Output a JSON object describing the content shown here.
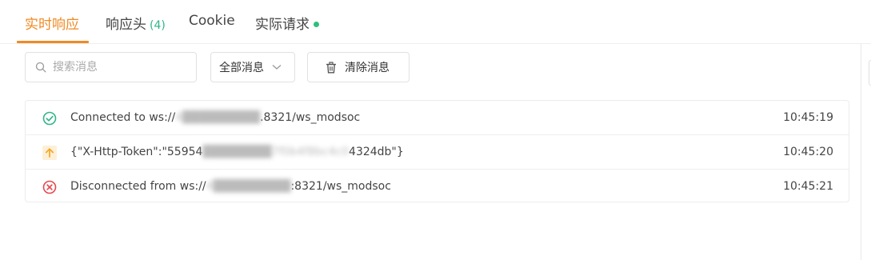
{
  "tabs": [
    {
      "label": "实时响应"
    },
    {
      "label": "响应头",
      "count": "(4)"
    },
    {
      "label": "Cookie"
    },
    {
      "label": "实际请求"
    }
  ],
  "toolbar": {
    "search_placeholder": "搜索消息",
    "filter_value": "全部消息",
    "clear_label": "清除消息"
  },
  "messages": [
    {
      "icon": "check-circle-icon",
      "prefix": "Connected to ws://",
      "redacted": "4█████████",
      "suffix": ".8321/ws_modsoc",
      "time": "10:45:19"
    },
    {
      "icon": "arrow-up-icon",
      "prefix": "{\"X-Http-Token\":\"55954",
      "redacted": "████████7f0b4f8bc4c0",
      "suffix": "4324db\"}",
      "time": "10:45:20"
    },
    {
      "icon": "close-circle-icon",
      "prefix": "Disconnected from ws://",
      "redacted": "4█████████",
      "suffix": ":8321/ws_modsoc",
      "time": "10:45:21"
    }
  ],
  "colors": {
    "accent": "#f08a24",
    "success": "#2fb58a",
    "warning": "#f5a623",
    "error": "#e5484d"
  }
}
